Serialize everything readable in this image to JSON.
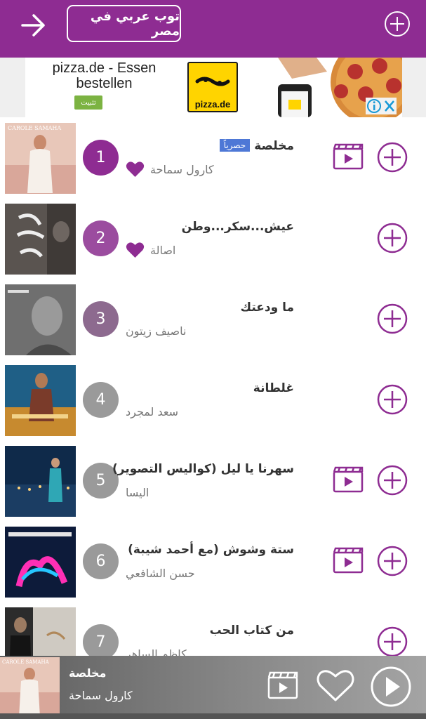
{
  "header": {
    "title": "توب عربي في مصر",
    "back_icon": "arrow-right-icon",
    "add_icon": "plus-circle-icon",
    "bg_color": "#8e2c92"
  },
  "ad": {
    "text": "pizza.de - Essen bestellen",
    "install_label": "تثبيت",
    "logo_text": "pizza.de"
  },
  "songs": [
    {
      "rank": "1",
      "title": "مخلصة",
      "artist": "كارول سماحة",
      "badge": "حصرياً",
      "liked": true,
      "video": true,
      "rank_color": "#8e2c92"
    },
    {
      "rank": "2",
      "title": "عيش...سكر...وطن",
      "artist": "اصالة",
      "liked": true,
      "video": false,
      "rank_color": "#9b4c9f"
    },
    {
      "rank": "3",
      "title": "ما ودعتك",
      "artist": "ناصيف زيتون",
      "liked": false,
      "video": false,
      "rank_color": "#8d6a8f"
    },
    {
      "rank": "4",
      "title": "غلطانة",
      "artist": "سعد لمجرد",
      "liked": false,
      "video": false,
      "rank_color": "#9a9a9a"
    },
    {
      "rank": "5",
      "title": "سهرنا يا ليل (كواليس التصوير)",
      "artist": "اليسا",
      "liked": false,
      "video": true,
      "rank_color": "#9a9a9a"
    },
    {
      "rank": "6",
      "title": "ستة وشوش (مع أحمد شيبة)",
      "artist": "حسن الشافعي",
      "liked": false,
      "video": true,
      "rank_color": "#9a9a9a"
    },
    {
      "rank": "7",
      "title": "من كتاب الحب",
      "artist": "كاظم الساهر",
      "liked": false,
      "video": false,
      "rank_color": "#9a9a9a"
    }
  ],
  "player": {
    "title": "مخلصة",
    "artist": "كارول سماحة",
    "video_icon": "video-icon",
    "heart_icon": "heart-outline-icon",
    "play_icon": "play-icon"
  },
  "accent": "#8e2c92"
}
